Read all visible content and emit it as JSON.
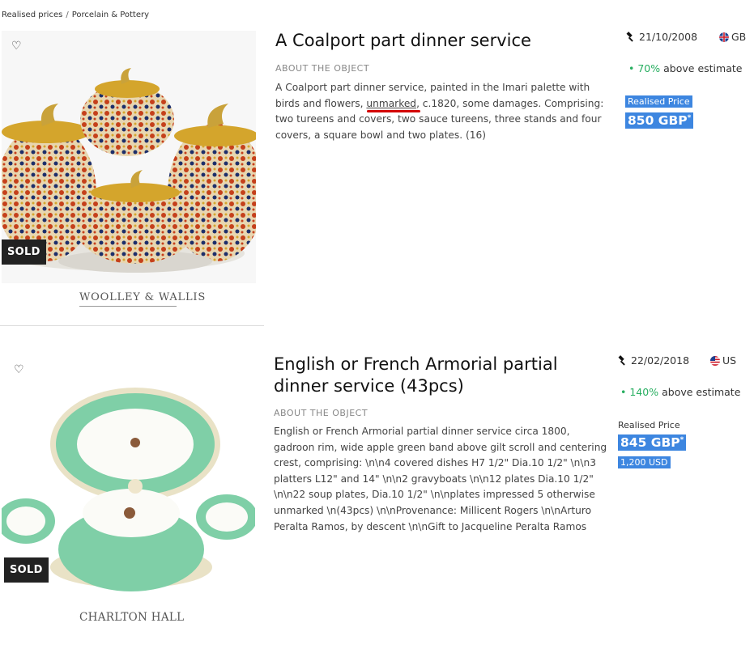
{
  "breadcrumb": [
    "Realised prices",
    "Porcelain & Pottery"
  ],
  "listings": [
    {
      "badge": "SOLD",
      "auctioneer": "WOOLLEY & WALLIS",
      "title": "A Coalport part dinner service",
      "about_heading": "ABOUT THE OBJECT",
      "description_before": "A Coalport part dinner service, painted in the Imari palette with birds and flowers, ",
      "description_marked": "unmarked",
      "description_after": ", c.1820, some damages. Comprising: two tureens and covers, two sauce tureens, three stands and four covers, a square bowl and two plates. (16)",
      "date": "21/10/2008",
      "country": "GB",
      "above_pct": "70%",
      "above_text": "above estimate",
      "realised_label": "Realised Price",
      "price_value": "850 GBP",
      "price_mark": "*",
      "icons": {
        "favorite": "heart-icon",
        "gavel": "gavel-icon",
        "flag": "uk-flag-icon"
      }
    },
    {
      "badge": "SOLD",
      "auctioneer": "CHARLTON HALL",
      "title": "English or French Armorial partial dinner service (43pcs)",
      "about_heading": "ABOUT THE OBJECT",
      "description": "English or French Armorial partial dinner service circa 1800, gadroon rim, wide apple green band above gilt scroll and centering crest, comprising: \\n\\n4 covered dishes H7 1/2\" Dia.10 1/2\" \\n\\n3 platters L12\" and 14\" \\n\\n2 gravyboats \\n\\n12 plates Dia.10 1/2\" \\n\\n22 soup plates, Dia.10 1/2\" \\n\\nplates impressed 5 otherwise unmarked \\n(43pcs) \\n\\nProvenance: Millicent Rogers \\n\\nArturo Peralta Ramos, by descent \\n\\nGift to Jacqueline Peralta Ramos",
      "date": "22/02/2018",
      "country": "US",
      "above_pct": "140%",
      "above_text": "above estimate",
      "realised_label": "Realised Price",
      "price_value": "845 GBP",
      "price_mark": "*",
      "secondary_price": "1,200 USD",
      "icons": {
        "favorite": "heart-icon",
        "gavel": "gavel-icon",
        "flag": "us-flag-icon"
      }
    }
  ],
  "colors": {
    "highlight": "#3d86e0",
    "positive": "#27ae60",
    "annotation": "#d30000",
    "sold_badge": "#222222"
  }
}
